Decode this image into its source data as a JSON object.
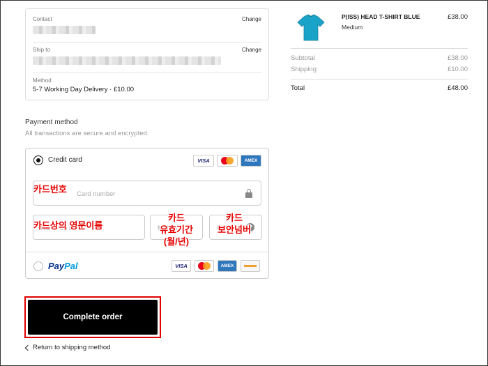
{
  "summary": {
    "contact_label": "Contact",
    "ship_to_label": "Ship to",
    "change_label": "Change",
    "method_label": "Method",
    "method_value": "5-7 Working Day Delivery · £10.00"
  },
  "payment": {
    "title": "Payment method",
    "subtitle": "All transactions are secure and encrypted.",
    "credit_card_label": "Credit card",
    "card_brands": [
      "VISA",
      "MASTERCARD",
      "AMEX"
    ],
    "card_number_placeholder": "Card number",
    "name_placeholder": "Name on card",
    "expiry_placeholder": "MM / YY",
    "security_placeholder": "CVV",
    "paypal_part1": "Pay",
    "paypal_part2": "Pal",
    "paypal_brands": [
      "VISA",
      "MASTERCARD",
      "AMEX",
      "CARD"
    ]
  },
  "annotations": {
    "card_number": "카드번호",
    "name_on_card": "카드상의 영문이름",
    "expiry_line1": "카드",
    "expiry_line2": "유효기간",
    "expiry_line3": "(월/년)",
    "security_line1": "카드",
    "security_line2": "보안넘버"
  },
  "actions": {
    "complete_order": "Complete order",
    "return_link": "Return to shipping method"
  },
  "order": {
    "product_name": "P(ISS) HEAD T-SHIRT BLUE",
    "variant": "Medium",
    "price": "£38.00",
    "subtotal_label": "Subtotal",
    "subtotal_value": "£38.00",
    "shipping_label": "Shipping",
    "shipping_value": "£10.00",
    "total_label": "Total",
    "total_value": "£48.00"
  },
  "colors": {
    "accent": "#000000",
    "annotation": "#e60000",
    "tshirt": "#1aa3c8"
  }
}
